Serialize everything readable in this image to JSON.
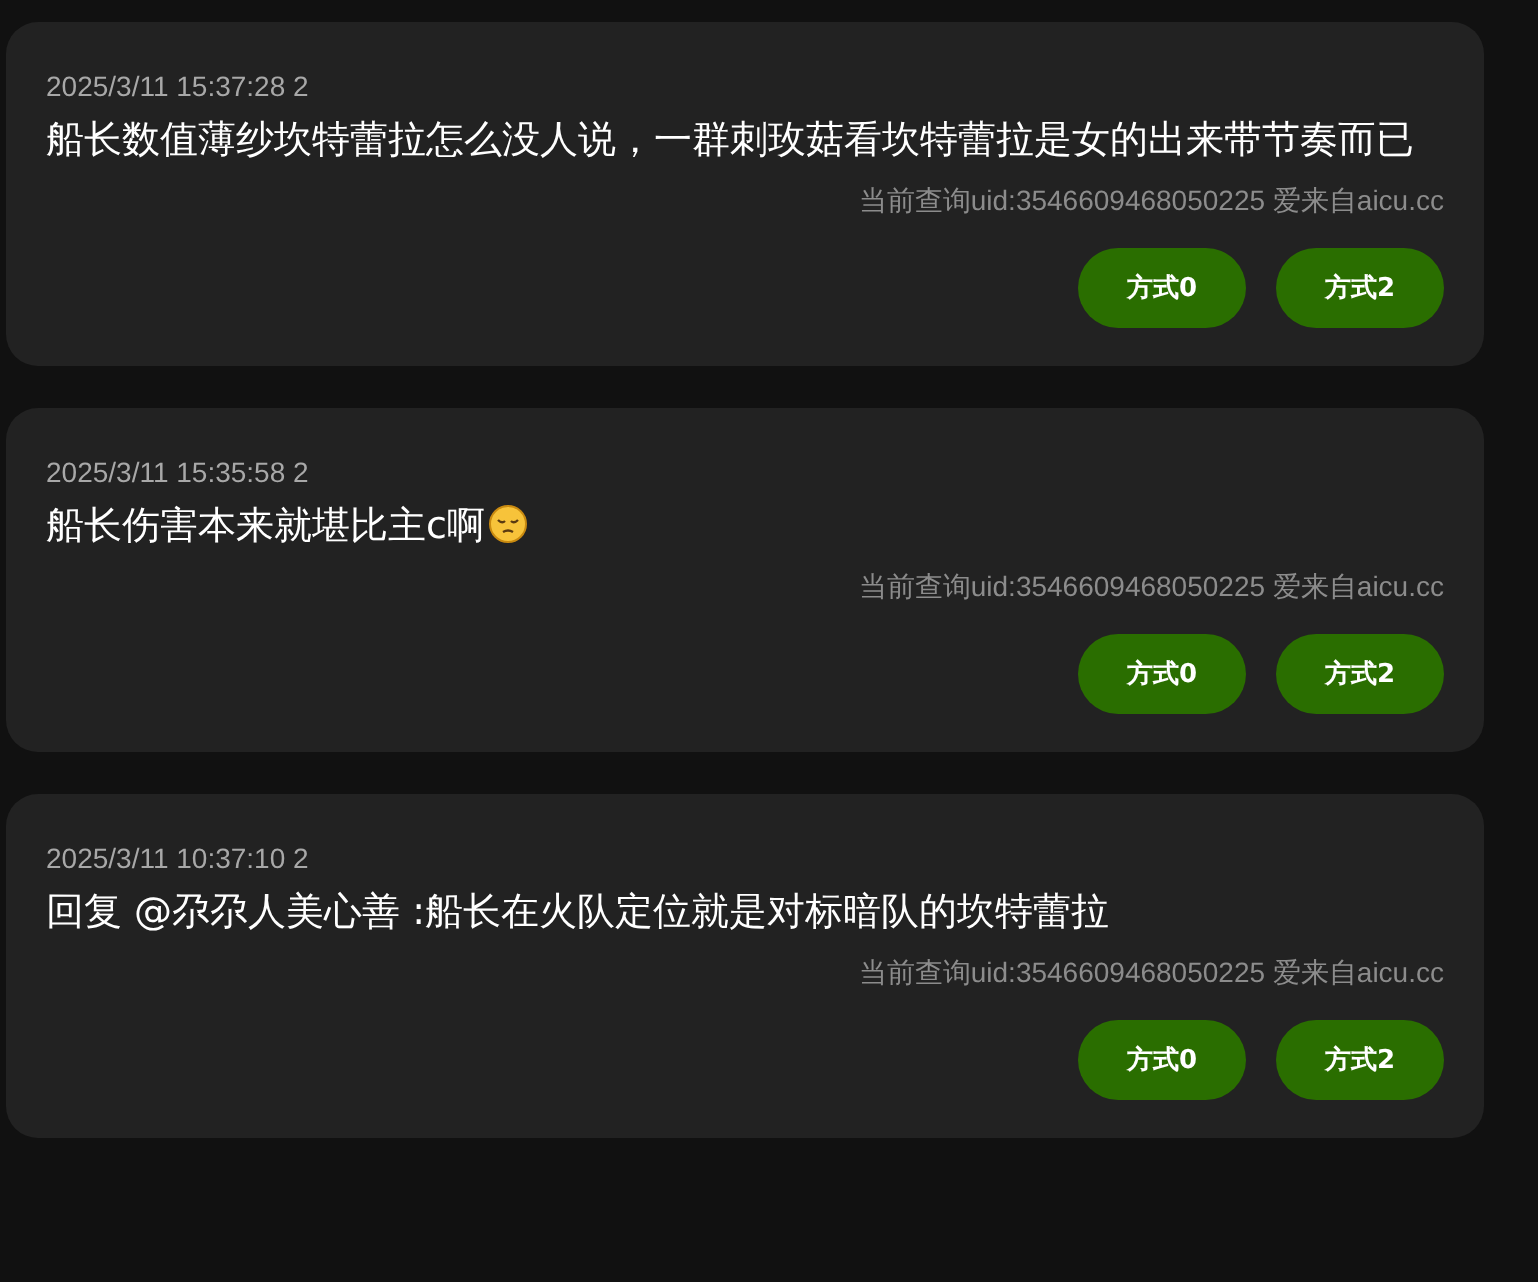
{
  "comments": [
    {
      "meta": "2025/3/11 15:37:28 2",
      "text": "船长数值薄纱坎特蕾拉怎么没人说，一群刺玫菇看坎特蕾拉是女的出来带节奏而已",
      "trailing_emoji": false,
      "source": "当前查询uid:3546609468050225 爱来自aicu.cc",
      "buttons": [
        "方式0",
        "方式2"
      ]
    },
    {
      "meta": "2025/3/11 15:35:58 2",
      "text": "船长伤害本来就堪比主c啊",
      "trailing_emoji": true,
      "source": "当前查询uid:3546609468050225 爱来自aicu.cc",
      "buttons": [
        "方式0",
        "方式2"
      ]
    },
    {
      "meta": "2025/3/11 10:37:10 2",
      "text": "回复 @尕尕人美心善 :船长在火队定位就是对标暗队的坎特蕾拉",
      "trailing_emoji": false,
      "source": "当前查询uid:3546609468050225 爱来自aicu.cc",
      "buttons": [
        "方式0",
        "方式2"
      ]
    }
  ]
}
